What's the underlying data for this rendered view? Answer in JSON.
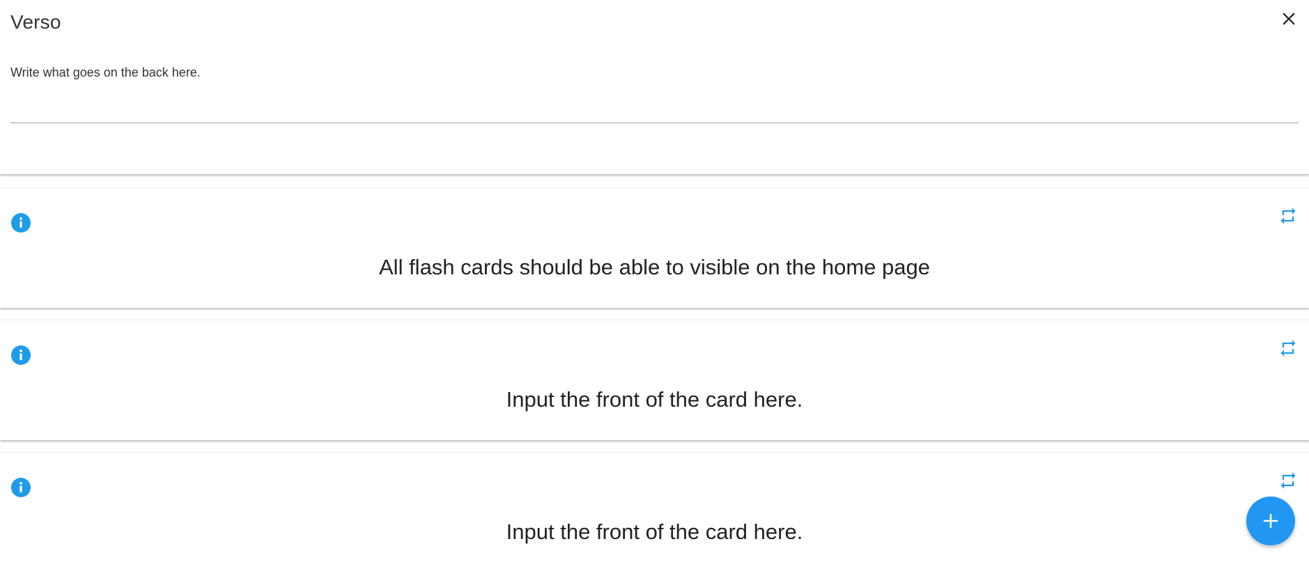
{
  "editor": {
    "title": "Verso",
    "helper_text": "Write what goes on the back here.",
    "input_value": "",
    "close_icon": "close-icon"
  },
  "cards": [
    {
      "front": "All flash cards should be able to visible on the home page",
      "info_icon": "info-icon",
      "flip_icon": "flip-icon"
    },
    {
      "front": "Input the front of the card here.",
      "info_icon": "info-icon",
      "flip_icon": "flip-icon"
    },
    {
      "front": "Input the front of the card here.",
      "info_icon": "info-icon",
      "flip_icon": "flip-icon"
    }
  ],
  "fab": {
    "icon": "plus-icon"
  },
  "colors": {
    "accent": "#2196f3",
    "icon_blue": "#1e9be9",
    "text": "#222222"
  }
}
